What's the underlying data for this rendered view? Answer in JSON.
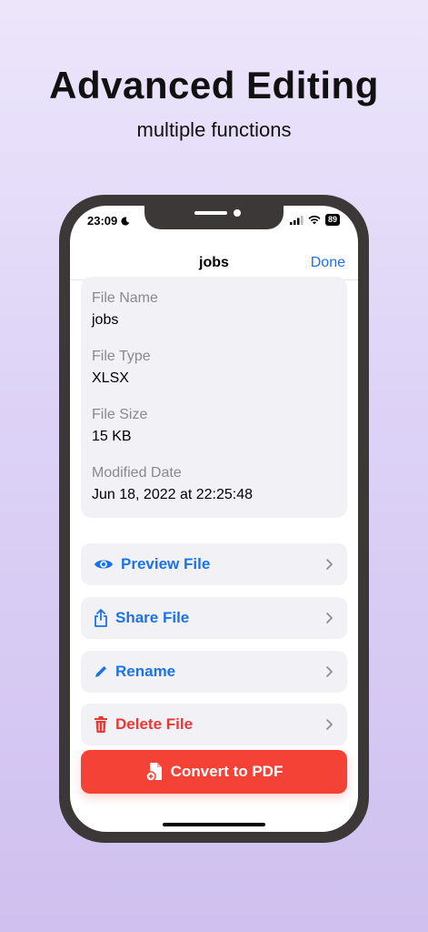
{
  "header": {
    "title": "Advanced Editing",
    "subtitle": "multiple functions"
  },
  "status_bar": {
    "time": "23:09",
    "battery": "89",
    "icons": [
      "moon-icon",
      "signal-icon",
      "wifi-icon",
      "battery-icon"
    ]
  },
  "nav": {
    "title": "jobs",
    "done_label": "Done"
  },
  "file_info": {
    "name_label": "File Name",
    "name_value": "jobs",
    "type_label": "File Type",
    "type_value": "XLSX",
    "size_label": "File Size",
    "size_value": "15 KB",
    "date_label": "Modified Date",
    "date_value": "Jun 18, 2022 at 22:25:48"
  },
  "actions": [
    {
      "label": "Preview File",
      "icon": "eye-icon",
      "color": "#1a73e8"
    },
    {
      "label": "Share File",
      "icon": "share-icon",
      "color": "#1a73e8"
    },
    {
      "label": "Rename",
      "icon": "pencil-icon",
      "color": "#1a73e8"
    },
    {
      "label": "Delete File",
      "icon": "trash-icon",
      "color": "#e53935"
    }
  ],
  "convert": {
    "label": "Convert to PDF",
    "icon": "pdf-convert-icon",
    "color": "#f44336"
  }
}
